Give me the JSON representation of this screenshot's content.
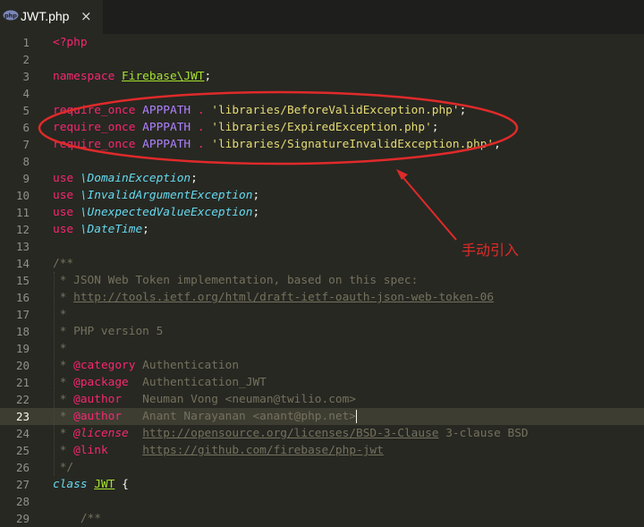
{
  "tab": {
    "filename": "JWT.php",
    "close_glyph": "×"
  },
  "annotation": {
    "text": "手动引入",
    "color": "#e02a2a"
  },
  "active_line": "23",
  "lines": [
    {
      "n": "1",
      "segs": [
        [
          "kw",
          "<?php"
        ]
      ]
    },
    {
      "n": "2",
      "segs": []
    },
    {
      "n": "3",
      "segs": [
        [
          "kw",
          "namespace "
        ],
        [
          "cls",
          "Firebase\\JWT"
        ],
        [
          "",
          "; "
        ]
      ]
    },
    {
      "n": "4",
      "segs": []
    },
    {
      "n": "5",
      "segs": [
        [
          "kw",
          "require_once "
        ],
        [
          "cst",
          "APPPATH"
        ],
        [
          "kw",
          " . "
        ],
        [
          "str",
          "'libraries/BeforeValidException.php'"
        ],
        [
          "",
          ";"
        ]
      ]
    },
    {
      "n": "6",
      "segs": [
        [
          "kw",
          "require_once "
        ],
        [
          "cst",
          "APPPATH"
        ],
        [
          "kw",
          " . "
        ],
        [
          "str",
          "'libraries/ExpiredException.php'"
        ],
        [
          "",
          ";"
        ]
      ]
    },
    {
      "n": "7",
      "segs": [
        [
          "kw",
          "require_once "
        ],
        [
          "cst",
          "APPPATH"
        ],
        [
          "kw",
          " . "
        ],
        [
          "str",
          "'libraries/SignatureInvalidException.php'"
        ],
        [
          "",
          ";"
        ]
      ]
    },
    {
      "n": "8",
      "segs": []
    },
    {
      "n": "9",
      "segs": [
        [
          "kw",
          "use "
        ],
        [
          "ital",
          "\\DomainException"
        ],
        [
          "",
          ";"
        ]
      ]
    },
    {
      "n": "10",
      "segs": [
        [
          "kw",
          "use "
        ],
        [
          "ital",
          "\\InvalidArgumentException"
        ],
        [
          "",
          ";"
        ]
      ]
    },
    {
      "n": "11",
      "segs": [
        [
          "kw",
          "use "
        ],
        [
          "ital",
          "\\UnexpectedValueException"
        ],
        [
          "",
          ";"
        ]
      ]
    },
    {
      "n": "12",
      "segs": [
        [
          "kw",
          "use "
        ],
        [
          "ital",
          "\\DateTime"
        ],
        [
          "",
          ";"
        ]
      ]
    },
    {
      "n": "13",
      "segs": []
    },
    {
      "n": "14",
      "segs": [
        [
          "cm",
          "/**"
        ]
      ]
    },
    {
      "n": "15",
      "segs": [
        [
          "cm",
          " * JSON Web Token implementation, based on this spec:"
        ]
      ]
    },
    {
      "n": "16",
      "segs": [
        [
          "cm",
          " * "
        ],
        [
          "cmurl",
          "http://tools.ietf.org/html/draft-ietf-oauth-json-web-token-06"
        ]
      ]
    },
    {
      "n": "17",
      "segs": [
        [
          "cm",
          " *"
        ]
      ]
    },
    {
      "n": "18",
      "segs": [
        [
          "cm",
          " * PHP version 5"
        ]
      ]
    },
    {
      "n": "19",
      "segs": [
        [
          "cm",
          " *"
        ]
      ]
    },
    {
      "n": "20",
      "segs": [
        [
          "cm",
          " * "
        ],
        [
          "cmtag",
          "@category"
        ],
        [
          "cm",
          " Authentication"
        ]
      ]
    },
    {
      "n": "21",
      "segs": [
        [
          "cm",
          " * "
        ],
        [
          "cmtag",
          "@package"
        ],
        [
          "cm",
          "  Authentication_JWT"
        ]
      ]
    },
    {
      "n": "22",
      "segs": [
        [
          "cm",
          " * "
        ],
        [
          "cmtag",
          "@author"
        ],
        [
          "cm",
          "   Neuman Vong <neuman@twilio.com>"
        ]
      ]
    },
    {
      "n": "23",
      "segs": [
        [
          "cm",
          " * "
        ],
        [
          "cmtag",
          "@author"
        ],
        [
          "cm",
          "   Anant Narayanan <anant@php.net>"
        ],
        [
          "cursor",
          ""
        ]
      ]
    },
    {
      "n": "24",
      "segs": [
        [
          "cm",
          " * "
        ],
        [
          "cmtag it",
          "@license"
        ],
        [
          "cm",
          "  "
        ],
        [
          "cmurl",
          "http://opensource.org/licenses/BSD-3-Clause"
        ],
        [
          "cm",
          " 3-clause BSD"
        ]
      ]
    },
    {
      "n": "25",
      "segs": [
        [
          "cm",
          " * "
        ],
        [
          "cmtag",
          "@link"
        ],
        [
          "cm",
          "     "
        ],
        [
          "cmurl",
          "https://github.com/firebase/php-jwt"
        ]
      ]
    },
    {
      "n": "26",
      "segs": [
        [
          "cm",
          " */"
        ]
      ]
    },
    {
      "n": "27",
      "segs": [
        [
          "stor",
          "class "
        ],
        [
          "cls",
          "JWT"
        ],
        [
          "",
          " {"
        ]
      ]
    },
    {
      "n": "28",
      "segs": []
    },
    {
      "n": "29",
      "segs": [
        [
          "cm",
          "    /**"
        ]
      ]
    }
  ]
}
